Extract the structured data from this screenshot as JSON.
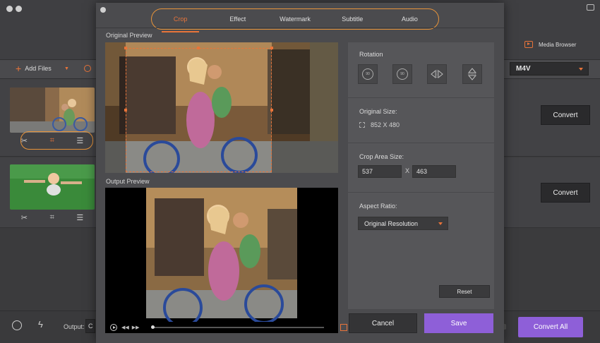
{
  "background": {
    "toolbar": {
      "add_files_label": "Add Files",
      "media_browser_label": "Media Browser",
      "output_format": "M4V"
    },
    "items": [
      {
        "convert_label": "Convert"
      },
      {
        "convert_label": "Convert"
      }
    ],
    "bottom": {
      "output_label": "Output:",
      "output_value": "C",
      "convert_all_label": "Convert All"
    }
  },
  "dialog": {
    "tabs": [
      {
        "label": "Crop",
        "active": true
      },
      {
        "label": "Effect",
        "active": false
      },
      {
        "label": "Watermark",
        "active": false
      },
      {
        "label": "Subtitle",
        "active": false
      },
      {
        "label": "Audio",
        "active": false
      }
    ],
    "original_preview_label": "Original Preview",
    "output_preview_label": "Output Preview",
    "rotation": {
      "title": "Rotation",
      "buttons": [
        "rotate-left-90-icon",
        "rotate-right-90-icon",
        "flip-horizontal-icon",
        "flip-vertical-icon"
      ],
      "rot_left_text": "90",
      "rot_right_text": "90"
    },
    "original_size": {
      "title": "Original Size:",
      "value": "852 X 480"
    },
    "crop_area": {
      "title": "Crop Area Size:",
      "width": "537",
      "separator": "X",
      "height": "463"
    },
    "aspect_ratio": {
      "title": "Aspect Ratio:",
      "selected": "Original Resolution"
    },
    "reset_label": "Reset",
    "cancel_label": "Cancel",
    "save_label": "Save",
    "colors": {
      "accent": "#e8743a",
      "primary_button": "#8e5fd8"
    }
  }
}
